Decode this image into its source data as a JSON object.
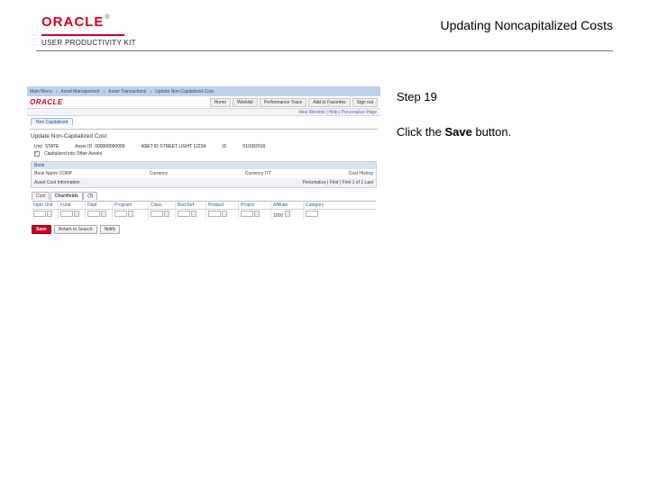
{
  "brand": {
    "name": "ORACLE",
    "tm": "®",
    "sub": "USER PRODUCTIVITY KIT"
  },
  "page_title": "Updating Noncapitalized Costs",
  "step": {
    "label": "Step 19",
    "text_before": "Click the ",
    "bold": "Save",
    "text_after": " button."
  },
  "ss": {
    "breadcrumb": [
      "Main Menu",
      "Asset Management",
      "Asset Transactions",
      "Update Non-Capitalized Cost"
    ],
    "oracle": "ORACLE",
    "tabs": [
      "Home",
      "Worklist",
      "Performance Trace",
      "Add to Favorites",
      "Sign out"
    ],
    "subnav": "New Window | Help | Personalize Page",
    "page_tab": "Non Capitalized",
    "section_title": "Update Non-Capitalized Cost",
    "form": {
      "unit": {
        "lbl": "Unit",
        "val": "STATE"
      },
      "asset": {
        "lbl": "Asset ID",
        "val": "000000000009"
      },
      "status_lbl": "ASET ID STREET LIGHT 12234",
      "id": {
        "lbl": "ID",
        "val": ""
      },
      "date": {
        "lbl": "",
        "val": "01/18/2016"
      },
      "check_label": "Capitalized into Other Assets"
    },
    "find": {
      "header": "Book",
      "book_lbl": "Book Name",
      "book_val": "CORP",
      "currency_lbl": "Currency",
      "currency_val": "",
      "currency2_lbl": "Currency",
      "currency2_val": "ITT",
      "date_lbl": "Cost History",
      "personalize": "Personalize | Find | ",
      "nav": "First 1 of 1 Last"
    },
    "small_tabs": {
      "cost": "Cost",
      "chartfields": "Chartfields",
      "third": "(3)"
    },
    "grid": {
      "heads": [
        "Oper Unit",
        "Fund",
        "Dept",
        "Program",
        "Class",
        "Bud Ref",
        "Product",
        "Project",
        "Affiliate",
        "Category"
      ],
      "row": [
        "",
        "",
        "",
        "",
        "",
        "",
        "",
        "",
        "1000",
        ""
      ]
    },
    "buttons": {
      "save": "Save",
      "return": "Return to Search",
      "notify": "Notify"
    }
  }
}
